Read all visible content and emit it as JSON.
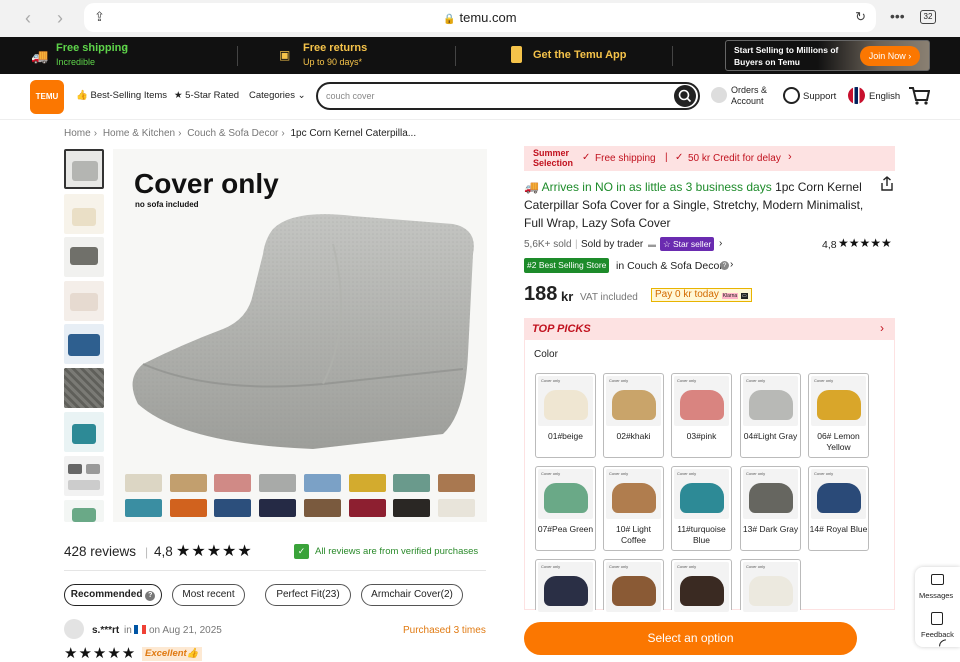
{
  "browser": {
    "url": "temu.com",
    "tabs_count": "32"
  },
  "promo": {
    "shipping_title": "Free shipping",
    "shipping_sub": "Incredible",
    "returns_title": "Free returns",
    "returns_sub": "Up to 90 days*",
    "app": "Get the Temu App",
    "selling_text": "Start Selling to Millions of Buyers on Temu",
    "join": "Join Now"
  },
  "header": {
    "logo": "TEMU",
    "best_selling": "Best-Selling Items",
    "five_star": "5-Star Rated",
    "categories": "Categories",
    "search_placeholder": "couch cover",
    "orders": "Orders & Account",
    "support": "Support",
    "language": "English"
  },
  "breadcrumbs": [
    "Home",
    "Home & Kitchen",
    "Couch & Sofa Decor",
    "1pc Corn Kernel Caterpilla..."
  ],
  "gallery": {
    "title": "Cover only",
    "subtitle": "no sofa included"
  },
  "reviews": {
    "count": "428 reviews",
    "rating": "4,8",
    "verified": "All reviews are from verified purchases",
    "filters": [
      "Recommended",
      "Most recent",
      "Perfect Fit(23)",
      "Armchair Cover(2)"
    ],
    "first": {
      "user": "s.***rt",
      "in": "in",
      "date": "on Aug 21, 2025",
      "purchased": "Purchased 3 times",
      "badge": "Excellent"
    }
  },
  "product": {
    "summer": "Summer Selection",
    "free_shipping": "Free shipping",
    "credit": "50 kr Credit for delay",
    "arrives": "Arrives in NO in as little as 3 business days",
    "title": "1pc Corn Kernel Caterpillar Sofa Cover for a Single, Stretchy, Modern Minimalist, Full Wrap, Lazy Sofa Cover",
    "sold": "5,6K+ sold",
    "sold_by": "Sold by trader",
    "star_seller": "Star seller",
    "rating": "4,8",
    "best_store": "#2 Best Selling Store",
    "store_in": "in Couch & Sofa Decor",
    "price": "188",
    "currency": "kr",
    "vat": "VAT included",
    "pay": "Pay 0 kr today",
    "klarna": "Klarna",
    "top_picks": "TOP PICKS",
    "color_label": "Color",
    "select": "Select an option"
  },
  "colors": [
    {
      "label": "01#beige",
      "color": "#efe6d2"
    },
    {
      "label": "02#khaki",
      "color": "#c9a46a"
    },
    {
      "label": "03#pink",
      "color": "#d98480"
    },
    {
      "label": "04#Light Gray",
      "color": "#b8b9b6"
    },
    {
      "label": "06# Lemon Yellow",
      "color": "#d9a62a"
    },
    {
      "label": "07#Pea Green",
      "color": "#6aa987"
    },
    {
      "label": "10# Light Coffee",
      "color": "#b07d4e"
    },
    {
      "label": "11#turquoise Blue",
      "color": "#2d8a96"
    },
    {
      "label": "13# Dark Gray",
      "color": "#666660"
    },
    {
      "label": "14# Royal Blue",
      "color": "#2a4a78"
    },
    {
      "label": "",
      "color": "#2a2f45"
    },
    {
      "label": "",
      "color": "#8a5a35"
    },
    {
      "label": "",
      "color": "#3a2a22"
    },
    {
      "label": "",
      "color": "#ece9df"
    }
  ],
  "floating": {
    "messages": "Messages",
    "feedback": "Feedback"
  }
}
